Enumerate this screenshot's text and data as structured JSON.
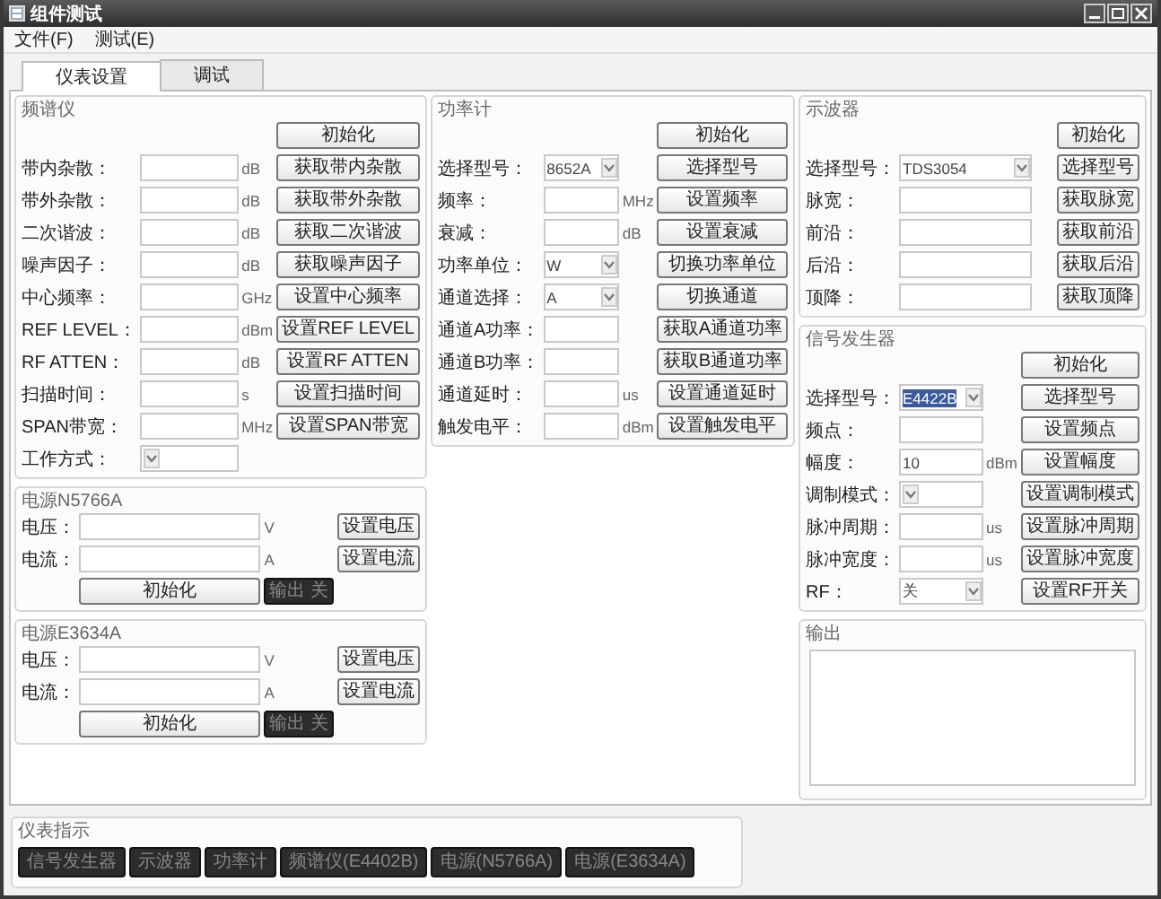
{
  "window": {
    "title": "组件测试"
  },
  "menu": [
    {
      "label": "文件(F)"
    },
    {
      "label": "测试(E)"
    }
  ],
  "tabs": [
    {
      "label": "仪表设置",
      "selected": true
    },
    {
      "label": "调试",
      "selected": false
    }
  ],
  "columns": [
    [
      {
        "title": "频谱仪",
        "kind": "form",
        "rows": [
          {
            "kind": "action",
            "button": "初始化"
          },
          {
            "kind": "input",
            "label": "带内杂散：",
            "unit": "dB",
            "button": "获取带内杂散"
          },
          {
            "kind": "input",
            "label": "带外杂散：",
            "unit": "dB",
            "button": "获取带外杂散"
          },
          {
            "kind": "input",
            "label": "二次谐波：",
            "unit": "dB",
            "button": "获取二次谐波"
          },
          {
            "kind": "input",
            "label": "噪声因子：",
            "unit": "dB",
            "button": "获取噪声因子"
          },
          {
            "kind": "input",
            "label": "中心频率：",
            "unit": "GHz",
            "button": "设置中心频率"
          },
          {
            "kind": "input",
            "label": "REF LEVEL：",
            "unit": "dBm",
            "button": "设置REF LEVEL"
          },
          {
            "kind": "input",
            "label": "RF ATTEN：",
            "unit": "dB",
            "button": "设置RF ATTEN"
          },
          {
            "kind": "input",
            "label": "扫描时间：",
            "unit": "s",
            "button": "设置扫描时间"
          },
          {
            "kind": "input",
            "label": "SPAN带宽：",
            "unit": "MHz",
            "button": "设置SPAN带宽"
          },
          {
            "kind": "select",
            "label": "工作方式："
          }
        ]
      },
      {
        "title": "电源N5766A",
        "kind": "form",
        "rows": [
          {
            "kind": "input",
            "label": "电压：",
            "unit": "V",
            "button": "设置电压"
          },
          {
            "kind": "input",
            "label": "电流：",
            "unit": "A",
            "button": "设置电流"
          },
          {
            "kind": "footer",
            "button": "初始化",
            "switch": "输出 关"
          }
        ]
      },
      {
        "title": "电源E3634A",
        "kind": "form",
        "rows": [
          {
            "kind": "input",
            "label": "电压：",
            "unit": "V",
            "button": "设置电压"
          },
          {
            "kind": "input",
            "label": "电流：",
            "unit": "A",
            "button": "设置电流"
          },
          {
            "kind": "footer",
            "button": "初始化",
            "switch": "输出 关"
          }
        ]
      }
    ],
    [
      {
        "title": "功率计",
        "kind": "form",
        "rows": [
          {
            "kind": "action",
            "button": "初始化"
          },
          {
            "kind": "select",
            "label": "选择型号：",
            "value": "8652A",
            "button": "选择型号"
          },
          {
            "kind": "input",
            "label": "频率：",
            "unit": "MHz",
            "button": "设置频率"
          },
          {
            "kind": "input",
            "label": "衰减：",
            "unit": "dB",
            "button": "设置衰减"
          },
          {
            "kind": "select",
            "label": "功率单位：",
            "value": "W",
            "button": "切换功率单位"
          },
          {
            "kind": "select",
            "label": "通道选择：",
            "value": "A",
            "button": "切换通道"
          },
          {
            "kind": "input",
            "label": "通道A功率：",
            "button": "获取A通道功率"
          },
          {
            "kind": "input",
            "label": "通道B功率：",
            "button": "获取B通道功率"
          },
          {
            "kind": "input",
            "label": "通道延时：",
            "unit": "us",
            "button": "设置通道延时"
          },
          {
            "kind": "input",
            "label": "触发电平：",
            "unit": "dBm",
            "button": "设置触发电平"
          }
        ]
      }
    ],
    [
      {
        "title": "示波器",
        "kind": "form",
        "rows": [
          {
            "kind": "action",
            "button": "初始化"
          },
          {
            "kind": "select",
            "label": "选择型号：",
            "value": "TDS3054",
            "button": "选择型号"
          },
          {
            "kind": "input",
            "label": "脉宽：",
            "button": "获取脉宽"
          },
          {
            "kind": "input",
            "label": "前沿：",
            "button": "获取前沿"
          },
          {
            "kind": "input",
            "label": "后沿：",
            "button": "获取后沿"
          },
          {
            "kind": "input",
            "label": "顶降：",
            "button": "获取顶降"
          }
        ]
      },
      {
        "title": "信号发生器",
        "kind": "form",
        "rows": [
          {
            "kind": "action",
            "button": "初始化"
          },
          {
            "kind": "select",
            "label": "选择型号：",
            "value": "E4422B",
            "focused": true,
            "button": "选择型号"
          },
          {
            "kind": "input",
            "label": "频点：",
            "button": "设置频点"
          },
          {
            "kind": "input",
            "label": "幅度：",
            "value": "10",
            "unit": "dBm",
            "button": "设置幅度"
          },
          {
            "kind": "select",
            "label": "调制模式：",
            "button": "设置调制模式"
          },
          {
            "kind": "input",
            "label": "脉冲周期：",
            "unit": "us",
            "button": "设置脉冲周期"
          },
          {
            "kind": "input",
            "label": "脉冲宽度：",
            "unit": "us",
            "button": "设置脉冲宽度"
          },
          {
            "kind": "select",
            "label": "RF：",
            "value": "关",
            "button": "设置RF开关"
          }
        ]
      },
      {
        "title": "输出",
        "kind": "textarea"
      }
    ]
  ],
  "indicators": {
    "title": "仪表指示",
    "buttons": [
      {
        "label": "信号发生器"
      },
      {
        "label": "示波器"
      },
      {
        "label": "功率计"
      },
      {
        "label": "频谱仪(E4402B)"
      },
      {
        "label": "电源(N5766A)"
      },
      {
        "label": "电源(E3634A)"
      }
    ]
  }
}
